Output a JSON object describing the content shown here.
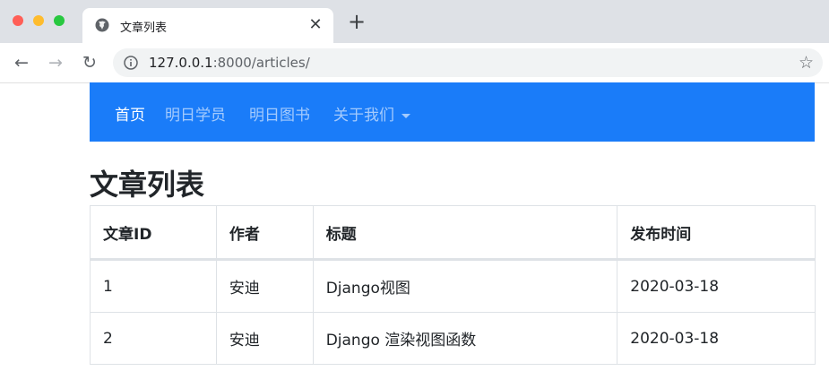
{
  "browser": {
    "tab_title": "文章列表",
    "close_glyph": "✕",
    "new_tab_glyph": "+",
    "url_host": "127.0.0.1",
    "url_path": ":8000/articles/",
    "back_glyph": "←",
    "forward_glyph": "→",
    "reload_glyph": "↻",
    "star_glyph": "☆"
  },
  "navbar": {
    "color": "#1a7cf9",
    "links": [
      {
        "label": "首页",
        "active": true
      },
      {
        "label": "明日学员",
        "active": false
      },
      {
        "label": "明日图书",
        "active": false
      },
      {
        "label": "关于我们",
        "active": false,
        "dropdown": true
      }
    ]
  },
  "page": {
    "title": "文章列表"
  },
  "table": {
    "headers": [
      "文章ID",
      "作者",
      "标题",
      "发布时间"
    ],
    "rows": [
      [
        "1",
        "安迪",
        "Django视图",
        "2020-03-18"
      ],
      [
        "2",
        "安迪",
        "Django 渲染视图函数",
        "2020-03-18"
      ]
    ]
  }
}
